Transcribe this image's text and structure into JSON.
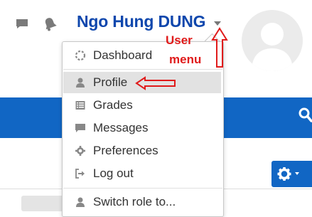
{
  "header": {
    "username": "Ngo Hung DUNG",
    "icons": [
      "messages-icon",
      "notifications-icon",
      "caret-down-icon"
    ]
  },
  "menu": {
    "items": [
      {
        "label": "Dashboard",
        "icon": "dashboard-icon"
      },
      {
        "label": "Profile",
        "icon": "user-icon",
        "active": true
      },
      {
        "label": "Grades",
        "icon": "grades-icon"
      },
      {
        "label": "Messages",
        "icon": "messages-icon"
      },
      {
        "label": "Preferences",
        "icon": "wrench-icon"
      },
      {
        "label": "Log out",
        "icon": "logout-icon"
      },
      {
        "label": "Switch role to...",
        "icon": "user-icon"
      }
    ]
  },
  "annotation": {
    "line1": "User",
    "line2": "menu",
    "color": "#e01b1b"
  },
  "colors": {
    "brand_blue": "#1166c4",
    "username_blue": "#0f47ad"
  }
}
